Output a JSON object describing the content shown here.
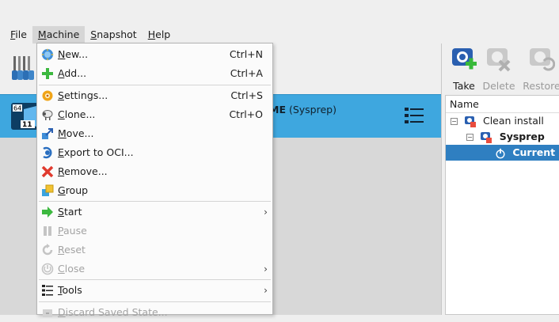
{
  "menubar": {
    "items": [
      {
        "label": "File",
        "mnemonic": "F",
        "rest": "ile"
      },
      {
        "label": "Machine",
        "mnemonic": "M",
        "rest": "achine"
      },
      {
        "label": "Snapshot",
        "mnemonic": "S",
        "rest": "napshot"
      },
      {
        "label": "Help",
        "mnemonic": "H",
        "rest": "elp"
      }
    ]
  },
  "vm": {
    "name_bold": "ME",
    "name_suffix": " (Sysprep)",
    "os_badge_top": "64",
    "os_badge_bottom": "11"
  },
  "machine_menu": {
    "items": [
      {
        "label": "New...",
        "mn": "N",
        "rest": "ew...",
        "shortcut": "Ctrl+N",
        "icon": "new-vm-icon",
        "disabled": false
      },
      {
        "label": "Add...",
        "mn": "A",
        "rest": "dd...",
        "shortcut": "Ctrl+A",
        "icon": "add-vm-icon",
        "disabled": false
      },
      {
        "label": "Settings...",
        "mn": "S",
        "rest": "ettings...",
        "shortcut": "Ctrl+S",
        "icon": "settings-gear-icon",
        "disabled": false
      },
      {
        "label": "Clone...",
        "mn": "C",
        "rest": "lone...",
        "shortcut": "Ctrl+O",
        "icon": "clone-sheep-icon",
        "disabled": false
      },
      {
        "label": "Move...",
        "mn": "M",
        "rest": "ove...",
        "shortcut": "",
        "icon": "move-arrows-icon",
        "disabled": false
      },
      {
        "label": "Export to OCI...",
        "mn": "E",
        "rest": "xport to OCI...",
        "shortcut": "",
        "icon": "export-oci-icon",
        "disabled": false
      },
      {
        "label": "Remove...",
        "mn": "R",
        "rest": "emove...",
        "shortcut": "",
        "icon": "remove-x-icon",
        "disabled": false
      },
      {
        "label": "Group",
        "mn": "G",
        "rest": "roup",
        "shortcut": "",
        "icon": "group-icon",
        "disabled": false
      },
      {
        "label": "Start",
        "mn": "S",
        "rest": "tart",
        "shortcut": "",
        "icon": "start-arrow-icon",
        "disabled": false,
        "submenu": true
      },
      {
        "label": "Pause",
        "mn": "P",
        "rest": "ause",
        "shortcut": "",
        "icon": "pause-icon",
        "disabled": true
      },
      {
        "label": "Reset",
        "mn": "R",
        "rest": "eset",
        "shortcut": "",
        "icon": "reset-icon",
        "disabled": true
      },
      {
        "label": "Close",
        "mn": "C",
        "rest": "lose",
        "shortcut": "",
        "icon": "power-icon",
        "disabled": true,
        "submenu": true
      },
      {
        "label": "Tools",
        "mn": "T",
        "rest": "ools",
        "shortcut": "",
        "icon": "tools-list-icon",
        "disabled": false,
        "submenu": true
      },
      {
        "label": "Discard Saved State...",
        "mn": "D",
        "rest": "iscard Saved State...",
        "shortcut": "",
        "icon": "discard-icon",
        "disabled": true
      }
    ]
  },
  "snapshot_toolbar": {
    "take": "Take",
    "delete": "Delete",
    "restore": "Restore"
  },
  "snapshot_tree": {
    "header": "Name",
    "rows": [
      {
        "label": "Clean install"
      },
      {
        "label": "Sysprep"
      },
      {
        "label": "Current S"
      }
    ]
  },
  "colors": {
    "accent": "#3ea7df",
    "selection": "#2f7fc1"
  }
}
